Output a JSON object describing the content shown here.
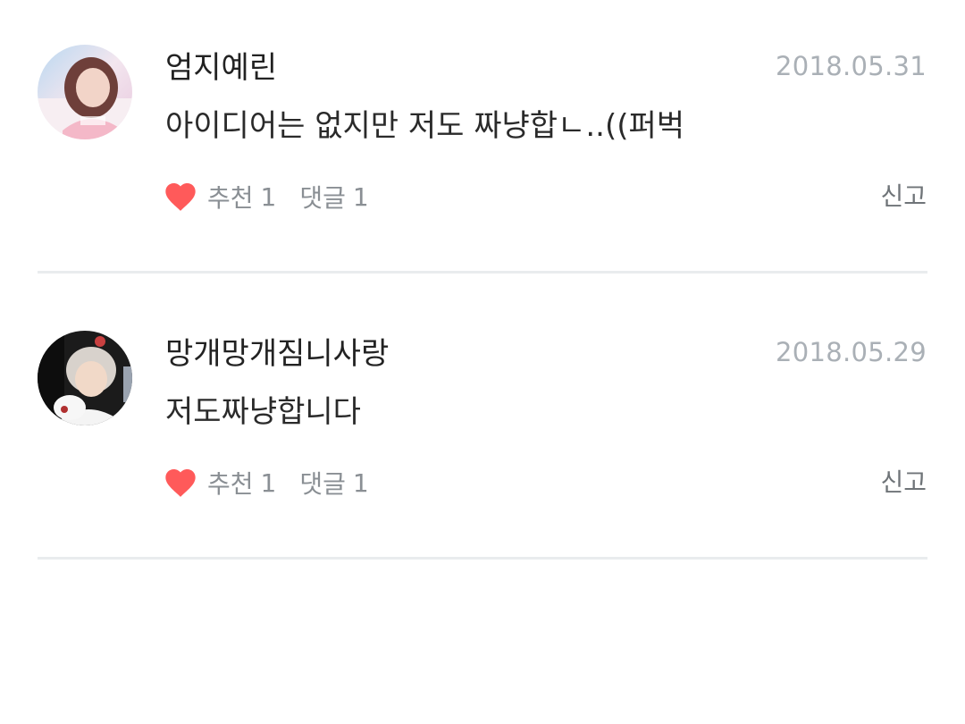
{
  "comments": [
    {
      "nickname": "엄지예린",
      "date": "2018.05.31",
      "text": "아이디어는 없지만 저도 짜냥합ㄴ..((퍼벅",
      "like_label": "추천",
      "like_count": "1",
      "reply_label": "댓글",
      "reply_count": "1",
      "report_label": "신고"
    },
    {
      "nickname": "망개망개짐니사랑",
      "date": "2018.05.29",
      "text": "저도짜냥합니다",
      "like_label": "추천",
      "like_count": "1",
      "reply_label": "댓글",
      "reply_count": "1",
      "report_label": "신고"
    }
  ],
  "colors": {
    "heart": "#ff5a5a",
    "date": "#aab0b6",
    "meta": "#8a8f94",
    "divider": "#e9ecee"
  },
  "icons": {
    "like": "heart-icon",
    "avatar_1": "user-avatar",
    "avatar_2": "user-avatar"
  }
}
